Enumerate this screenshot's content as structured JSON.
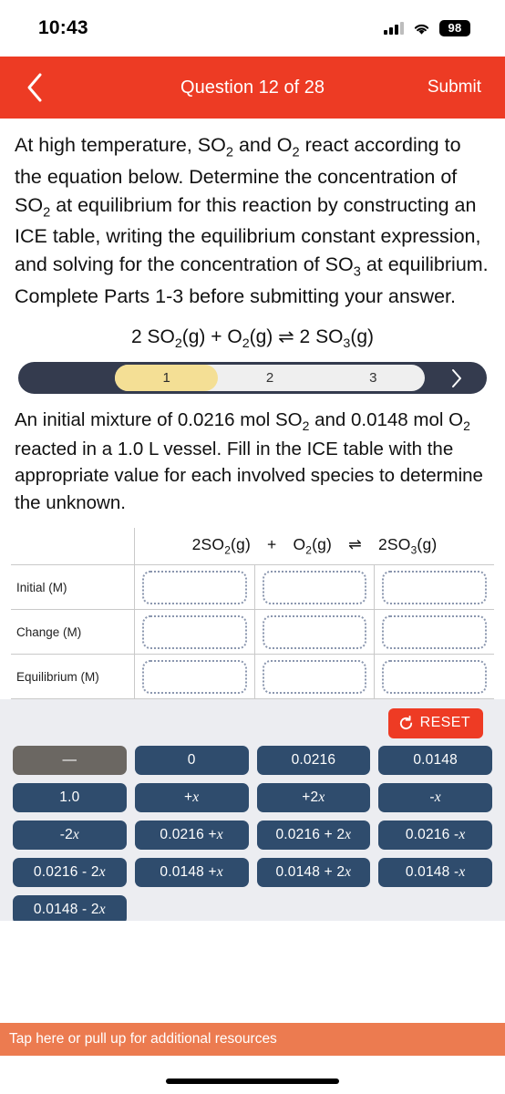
{
  "status_bar": {
    "time": "10:43",
    "battery": "98",
    "signal_icon": "cellular-signal-icon",
    "wifi_icon": "wifi-icon"
  },
  "nav": {
    "back_icon": "chevron-left-icon",
    "title": "Question 12 of 28",
    "submit_label": "Submit"
  },
  "question": {
    "prompt": "At high temperature, SO₂ and O₂ react according to the equation below. Determine the concentration of SO₂ at equilibrium for this reaction by constructing an ICE table, writing the equilibrium constant expression, and solving for the concentration of SO₃ at equilibrium. Complete Parts 1-3 before submitting your answer.",
    "equation": "2 SO₂(g) + O₂(g) ⇌ 2 SO₃(g)",
    "subprompt": "An initial mixture of 0.0216 mol SO₂ and 0.0148 mol O₂ reacted in a 1.0 L vessel. Fill in the ICE table with the appropriate value for each involved species to determine the unknown."
  },
  "steps": {
    "items": [
      {
        "label": "1",
        "active": true
      },
      {
        "label": "2",
        "active": false
      },
      {
        "label": "3",
        "active": false
      }
    ],
    "next_icon": "chevron-right-icon"
  },
  "ice_table": {
    "header": {
      "reactant1": "2SO₂(g)",
      "plus": "+",
      "reactant2": "O₂(g)",
      "arrow": "⇌",
      "product": "2SO₃(g)"
    },
    "rows": [
      {
        "label": "Initial (M)",
        "cells": [
          "",
          "",
          ""
        ]
      },
      {
        "label": "Change (M)",
        "cells": [
          "",
          "",
          ""
        ]
      },
      {
        "label": "Equilibrium (M)",
        "cells": [
          "",
          "",
          ""
        ]
      }
    ]
  },
  "tray": {
    "reset_label": "RESET",
    "reset_icon": "refresh-ccw-icon",
    "tiles": [
      {
        "label": "—",
        "disabled": true
      },
      {
        "label": "0",
        "disabled": false
      },
      {
        "label": "0.0216",
        "disabled": false
      },
      {
        "label": "0.0148",
        "disabled": false
      },
      {
        "label": "1.0",
        "disabled": false
      },
      {
        "label": "+x",
        "disabled": false
      },
      {
        "label": "+2x",
        "disabled": false
      },
      {
        "label": "-x",
        "disabled": false
      },
      {
        "label": "-2x",
        "disabled": false
      },
      {
        "label": "0.0216 + x",
        "disabled": false
      },
      {
        "label": "0.0216 + 2x",
        "disabled": false
      },
      {
        "label": "0.0216 - x",
        "disabled": false
      },
      {
        "label": "0.0216 - 2x",
        "disabled": false
      },
      {
        "label": "0.0148 + x",
        "disabled": false
      },
      {
        "label": "0.0148 + 2x",
        "disabled": false
      },
      {
        "label": "0.0148 - x",
        "disabled": false
      },
      {
        "label": "0.0148 - 2x",
        "disabled": false
      }
    ]
  },
  "bottom": {
    "resource_label": "Tap here or pull up for additional resources"
  },
  "colors": {
    "nav_red": "#ED3B24",
    "reset_red": "#EE3B24",
    "tile_navy": "#2F4C6D",
    "tile_disabled": "#6B6762",
    "step_active_yellow": "#F4DF95",
    "step_bar_dark": "#343B4E",
    "resource_orange": "#EC7B50",
    "tray_bg": "#ECEDF1"
  }
}
